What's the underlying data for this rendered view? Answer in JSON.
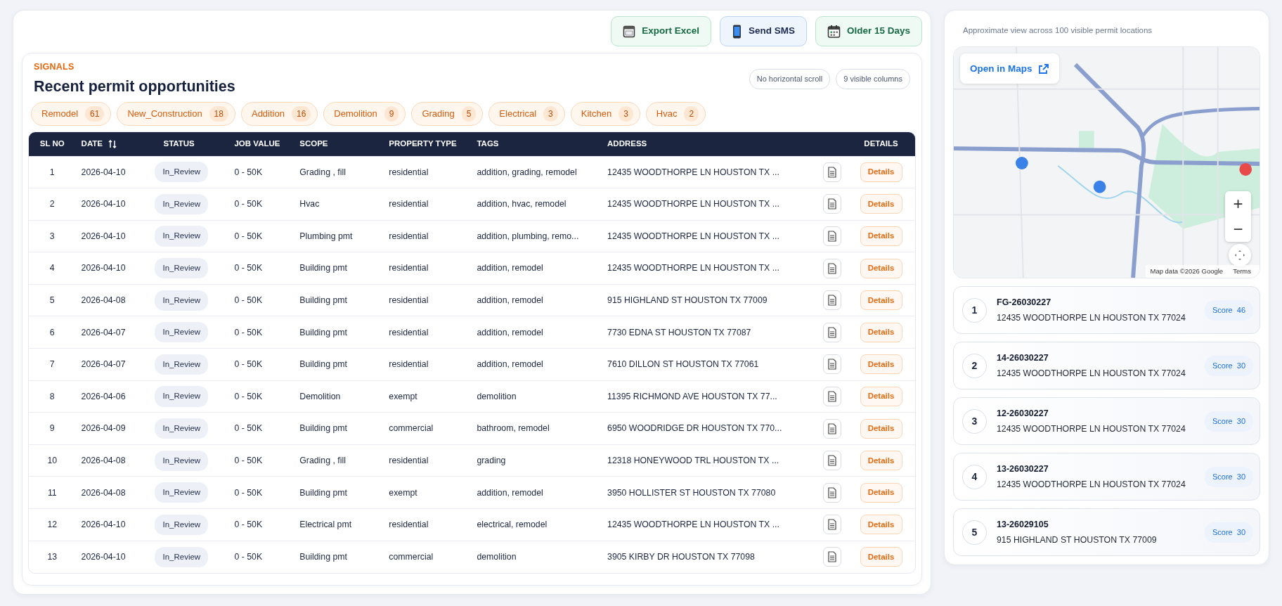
{
  "toolbar": {
    "buttons": [
      {
        "label": "Export Excel",
        "kind": "excel"
      },
      {
        "label": "Send SMS",
        "kind": "sms"
      },
      {
        "label": "Older 15 Days",
        "kind": "calendar"
      }
    ]
  },
  "signals": {
    "eyebrow": "SIGNALS",
    "title": "Recent permit opportunities",
    "badges": [
      "No horizontal scroll",
      "9 visible columns"
    ],
    "chips": [
      {
        "label": "Remodel",
        "count": "61"
      },
      {
        "label": "New_Construction",
        "count": "18"
      },
      {
        "label": "Addition",
        "count": "16"
      },
      {
        "label": "Demolition",
        "count": "9"
      },
      {
        "label": "Grading",
        "count": "5"
      },
      {
        "label": "Electrical",
        "count": "3"
      },
      {
        "label": "Kitchen",
        "count": "3"
      },
      {
        "label": "Hvac",
        "count": "2"
      }
    ]
  },
  "table": {
    "columns": [
      {
        "label": "SL NO",
        "sortable": false
      },
      {
        "label": "DATE",
        "sortable": true
      },
      {
        "label": "STATUS",
        "sortable": false
      },
      {
        "label": "JOB VALUE",
        "sortable": false
      },
      {
        "label": "SCOPE",
        "sortable": false
      },
      {
        "label": "PROPERTY TYPE",
        "sortable": false
      },
      {
        "label": "TAGS",
        "sortable": false
      },
      {
        "label": "ADDRESS",
        "sortable": false
      },
      {
        "label": "DETAILS",
        "sortable": false
      }
    ],
    "rows": [
      {
        "sl": "1",
        "date": "2026-04-10",
        "status": "In_Review",
        "job_value": "0 - 50K",
        "scope": "Grading , fill",
        "property_type": "residential",
        "tags": "addition, grading, remodel",
        "address": "12435 WOODTHORPE LN HOUSTON TX ...",
        "action": "Details"
      },
      {
        "sl": "2",
        "date": "2026-04-10",
        "status": "In_Review",
        "job_value": "0 - 50K",
        "scope": "Hvac",
        "property_type": "residential",
        "tags": "addition, hvac, remodel",
        "address": "12435 WOODTHORPE LN HOUSTON TX ...",
        "action": "Details"
      },
      {
        "sl": "3",
        "date": "2026-04-10",
        "status": "In_Review",
        "job_value": "0 - 50K",
        "scope": "Plumbing pmt",
        "property_type": "residential",
        "tags": "addition, plumbing, remo...",
        "address": "12435 WOODTHORPE LN HOUSTON TX ...",
        "action": "Details"
      },
      {
        "sl": "4",
        "date": "2026-04-10",
        "status": "In_Review",
        "job_value": "0 - 50K",
        "scope": "Building pmt",
        "property_type": "residential",
        "tags": "addition, remodel",
        "address": "12435 WOODTHORPE LN HOUSTON TX ...",
        "action": "Details"
      },
      {
        "sl": "5",
        "date": "2026-04-08",
        "status": "In_Review",
        "job_value": "0 - 50K",
        "scope": "Building pmt",
        "property_type": "residential",
        "tags": "addition, remodel",
        "address": "915 HIGHLAND ST HOUSTON TX 77009",
        "action": "Details"
      },
      {
        "sl": "6",
        "date": "2026-04-07",
        "status": "In_Review",
        "job_value": "0 - 50K",
        "scope": "Building pmt",
        "property_type": "residential",
        "tags": "addition, remodel",
        "address": "7730 EDNA ST HOUSTON TX 77087",
        "action": "Details"
      },
      {
        "sl": "7",
        "date": "2026-04-07",
        "status": "In_Review",
        "job_value": "0 - 50K",
        "scope": "Building pmt",
        "property_type": "residential",
        "tags": "addition, remodel",
        "address": "7610 DILLON ST HOUSTON TX 77061",
        "action": "Details"
      },
      {
        "sl": "8",
        "date": "2026-04-06",
        "status": "In_Review",
        "job_value": "0 - 50K",
        "scope": "Demolition",
        "property_type": "exempt",
        "tags": "demolition",
        "address": "11395 RICHMOND AVE HOUSTON TX 77...",
        "action": "Details"
      },
      {
        "sl": "9",
        "date": "2026-04-09",
        "status": "In_Review",
        "job_value": "0 - 50K",
        "scope": "Building pmt",
        "property_type": "commercial",
        "tags": "bathroom, remodel",
        "address": "6950 WOODRIDGE DR HOUSTON TX 770...",
        "action": "Details"
      },
      {
        "sl": "10",
        "date": "2026-04-08",
        "status": "In_Review",
        "job_value": "0 - 50K",
        "scope": "Grading , fill",
        "property_type": "residential",
        "tags": "grading",
        "address": "12318 HONEYWOOD TRL HOUSTON TX ...",
        "action": "Details"
      },
      {
        "sl": "11",
        "date": "2026-04-08",
        "status": "In_Review",
        "job_value": "0 - 50K",
        "scope": "Building pmt",
        "property_type": "exempt",
        "tags": "addition, remodel",
        "address": "3950 HOLLISTER ST HOUSTON TX 77080",
        "action": "Details"
      },
      {
        "sl": "12",
        "date": "2026-04-10",
        "status": "In_Review",
        "job_value": "0 - 50K",
        "scope": "Electrical pmt",
        "property_type": "residential",
        "tags": "electrical, remodel",
        "address": "12435 WOODTHORPE LN HOUSTON TX ...",
        "action": "Details"
      },
      {
        "sl": "13",
        "date": "2026-04-10",
        "status": "In_Review",
        "job_value": "0 - 50K",
        "scope": "Building pmt",
        "property_type": "commercial",
        "tags": "demolition",
        "address": "3905 KIRBY DR HOUSTON TX 77098",
        "action": "Details"
      }
    ]
  },
  "map_panel": {
    "caption": "Approximate view across 100 visible permit locations",
    "map": {
      "kind": "picture",
      "open_link": "Open in Maps",
      "zoom_in": "+",
      "zoom_out": "−",
      "attribution": "Map data ©2026 Google",
      "terms": "Terms"
    },
    "items": [
      {
        "rank": "1",
        "permit": "FG-26030227",
        "address": "12435 WOODTHORPE LN HOUSTON TX 77024",
        "score_label": "Score",
        "score": "46"
      },
      {
        "rank": "2",
        "permit": "14-26030227",
        "address": "12435 WOODTHORPE LN HOUSTON TX 77024",
        "score_label": "Score",
        "score": "30"
      },
      {
        "rank": "3",
        "permit": "12-26030227",
        "address": "12435 WOODTHORPE LN HOUSTON TX 77024",
        "score_label": "Score",
        "score": "30"
      },
      {
        "rank": "4",
        "permit": "13-26030227",
        "address": "12435 WOODTHORPE LN HOUSTON TX 77024",
        "score_label": "Score",
        "score": "30"
      },
      {
        "rank": "5",
        "permit": "13-26029105",
        "address": "915 HIGHLAND ST HOUSTON TX 77009",
        "score_label": "Score",
        "score": "30"
      }
    ]
  }
}
